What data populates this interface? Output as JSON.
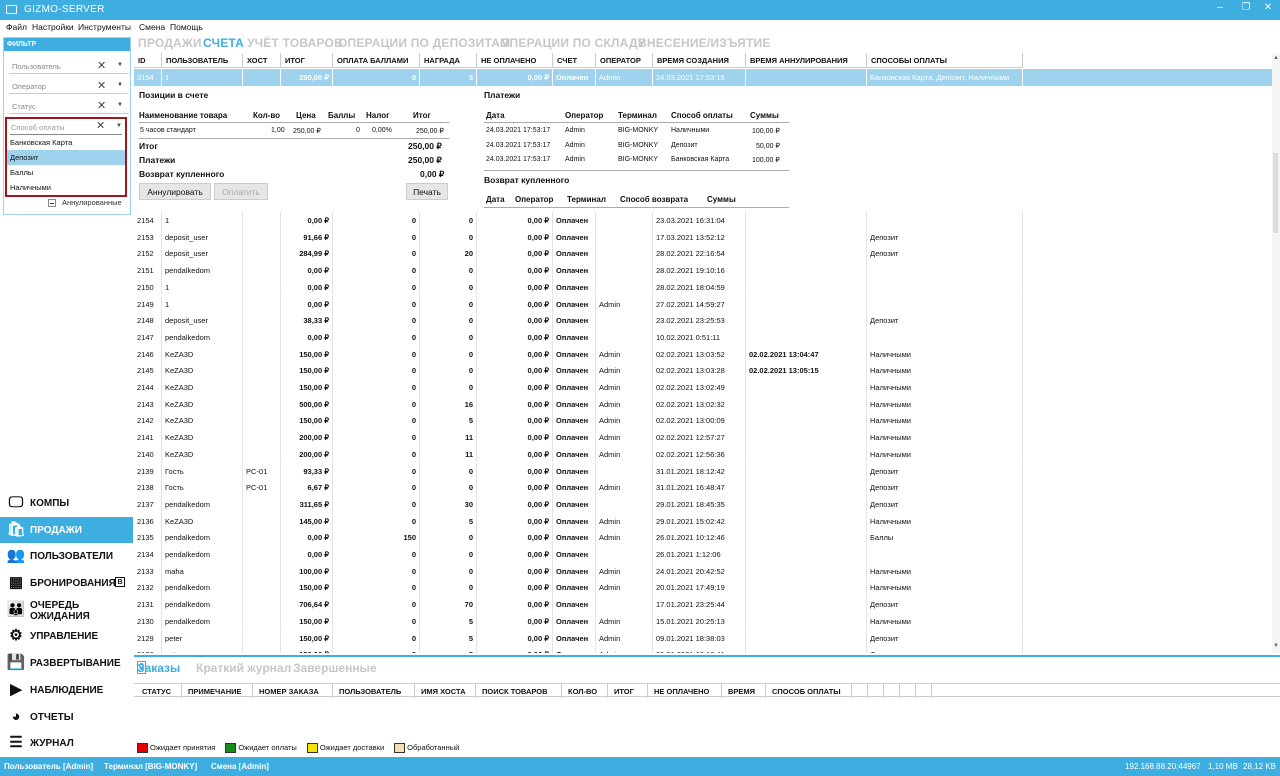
{
  "window": {
    "title": "GIZMO-SERVER"
  },
  "menu": [
    "Файл",
    "Настройки",
    "Инструменты",
    "Смена",
    "Помощь"
  ],
  "filter": {
    "header": "ФИЛЬТР",
    "user_placeholder": "Пользователь",
    "operator_placeholder": "Оператор",
    "status_placeholder": "Статус",
    "payment_placeholder": "Способ оплаты",
    "payment_options": [
      "Банковская Карта",
      "Депозит",
      "Баллы",
      "Наличными"
    ],
    "highlighted_option": "Депозит",
    "annulled_label": "Аннулированные"
  },
  "nav": [
    {
      "label": "КОМПЫ",
      "icon": "monitor-icon"
    },
    {
      "label": "ПРОДАЖИ",
      "icon": "shopping-bag-icon",
      "active": true
    },
    {
      "label": "ПОЛЬЗОВАТЕЛИ",
      "icon": "users-icon"
    },
    {
      "label": "БРОНИРОВАНИЯ",
      "icon": "calendar-icon",
      "badge": "B"
    },
    {
      "label": "ОЧЕРЕДЬ",
      "label2": "ОЖИДАНИЯ",
      "icon": "queue-icon"
    },
    {
      "label": "УПРАВЛЕНИЕ",
      "icon": "gear-icon"
    },
    {
      "label": "РАЗВЕРТЫВАНИЕ",
      "icon": "disk-icon"
    },
    {
      "label": "НАБЛЮДЕНИЕ",
      "icon": "screen-play-icon"
    },
    {
      "label": "ОТЧЕТЫ",
      "icon": "pie-chart-icon"
    },
    {
      "label": "ЖУРНАЛ",
      "icon": "list-icon"
    }
  ],
  "tabs": [
    "ПРОДАЖИ",
    "СЧЕТА",
    "УЧЁТ ТОВАРОВ",
    "ОПЕРАЦИИ ПО ДЕПОЗИТАМ",
    "ОПЕРАЦИИ ПО СКЛАДУ",
    "ВНЕСЕНИЕ/ИЗЪЯТИЕ"
  ],
  "active_tab": "СЧЕТА",
  "grid": {
    "columns": [
      "ID",
      "ПОЛЬЗОВАТЕЛЬ",
      "ХОСТ",
      "ИТОГ",
      "ОПЛАТА БАЛЛАМИ",
      "НАГРАДА",
      "НЕ ОПЛАЧЕНО",
      "СЧЕТ",
      "ОПЕРАТОР",
      "ВРЕМЯ СОЗДАНИЯ",
      "ВРЕМЯ АННУЛИРОВАНИЯ",
      "СПОСОБЫ ОПЛАТЫ"
    ],
    "selected": [
      "3154",
      "1",
      "",
      "250,00 ₽",
      "0",
      "3",
      "0,00 ₽",
      "Оплачен",
      "Admin",
      "24.03.2021 17:53:16",
      "",
      "Банковская Карта, Депозит, Наличными"
    ],
    "rows": [
      [
        "2154",
        "1",
        "",
        "0,00 ₽",
        "0",
        "0",
        "0,00 ₽",
        "Оплачен",
        "",
        "23.03.2021 16:31:04",
        "",
        ""
      ],
      [
        "2153",
        "deposit_user",
        "",
        "91,66 ₽",
        "0",
        "0",
        "0,00 ₽",
        "Оплачен",
        "",
        "17.03.2021 13:52:12",
        "",
        "Депозит"
      ],
      [
        "2152",
        "deposit_user",
        "",
        "284,99 ₽",
        "0",
        "20",
        "0,00 ₽",
        "Оплачен",
        "",
        "28.02.2021 22:16:54",
        "",
        "Депозит"
      ],
      [
        "2151",
        "pendalkedom",
        "",
        "0,00 ₽",
        "0",
        "0",
        "0,00 ₽",
        "Оплачен",
        "",
        "28.02.2021 19:10:16",
        "",
        ""
      ],
      [
        "2150",
        "1",
        "",
        "0,00 ₽",
        "0",
        "0",
        "0,00 ₽",
        "Оплачен",
        "",
        "28.02.2021 18:04:59",
        "",
        ""
      ],
      [
        "2149",
        "1",
        "",
        "0,00 ₽",
        "0",
        "0",
        "0,00 ₽",
        "Оплачен",
        "Admin",
        "27.02.2021 14:59:27",
        "",
        ""
      ],
      [
        "2148",
        "deposit_user",
        "",
        "38,33 ₽",
        "0",
        "0",
        "0,00 ₽",
        "Оплачен",
        "",
        "23.02.2021 23:25:53",
        "",
        "Депозит"
      ],
      [
        "2147",
        "pendalkedom",
        "",
        "0,00 ₽",
        "0",
        "0",
        "0,00 ₽",
        "Оплачен",
        "",
        "10.02.2021 0:51:11",
        "",
        ""
      ],
      [
        "2146",
        "KeZA3D",
        "",
        "150,00 ₽",
        "0",
        "0",
        "0,00 ₽",
        "Оплачен",
        "Admin",
        "02.02.2021 13:03:52",
        "02.02.2021 13:04:47",
        "Наличными"
      ],
      [
        "2145",
        "KeZA3D",
        "",
        "150,00 ₽",
        "0",
        "0",
        "0,00 ₽",
        "Оплачен",
        "Admin",
        "02.02.2021 13:03:28",
        "02.02.2021 13:05:15",
        "Наличными"
      ],
      [
        "2144",
        "KeZA3D",
        "",
        "150,00 ₽",
        "0",
        "0",
        "0,00 ₽",
        "Оплачен",
        "Admin",
        "02.02.2021 13:02:49",
        "",
        "Наличными"
      ],
      [
        "2143",
        "KeZA3D",
        "",
        "500,00 ₽",
        "0",
        "16",
        "0,00 ₽",
        "Оплачен",
        "Admin",
        "02.02.2021 13:02:32",
        "",
        "Наличными"
      ],
      [
        "2142",
        "KeZA3D",
        "",
        "150,00 ₽",
        "0",
        "5",
        "0,00 ₽",
        "Оплачен",
        "Admin",
        "02.02.2021 13:00:09",
        "",
        "Наличными"
      ],
      [
        "2141",
        "KeZA3D",
        "",
        "200,00 ₽",
        "0",
        "11",
        "0,00 ₽",
        "Оплачен",
        "Admin",
        "02.02.2021 12:57:27",
        "",
        "Наличными"
      ],
      [
        "2140",
        "KeZA3D",
        "",
        "200,00 ₽",
        "0",
        "11",
        "0,00 ₽",
        "Оплачен",
        "Admin",
        "02.02.2021 12:56:36",
        "",
        "Наличными"
      ],
      [
        "2139",
        "Гость",
        "PC-01",
        "93,33 ₽",
        "0",
        "0",
        "0,00 ₽",
        "Оплачен",
        "",
        "31.01.2021 18:12:42",
        "",
        "Депозит"
      ],
      [
        "2138",
        "Гость",
        "PC-01",
        "6,67 ₽",
        "0",
        "0",
        "0,00 ₽",
        "Оплачен",
        "Admin",
        "31.01.2021 16:48:47",
        "",
        "Депозит"
      ],
      [
        "2137",
        "pendalkedom",
        "",
        "311,65 ₽",
        "0",
        "30",
        "0,00 ₽",
        "Оплачен",
        "",
        "29.01.2021 18:45:35",
        "",
        "Депозит"
      ],
      [
        "2136",
        "KeZA3D",
        "",
        "145,00 ₽",
        "0",
        "5",
        "0,00 ₽",
        "Оплачен",
        "Admin",
        "29.01.2021 15:02:42",
        "",
        "Наличными"
      ],
      [
        "2135",
        "pendalkedom",
        "",
        "0,00 ₽",
        "150",
        "0",
        "0,00 ₽",
        "Оплачен",
        "Admin",
        "26.01.2021 10:12:46",
        "",
        "Баллы"
      ],
      [
        "2134",
        "pendalkedom",
        "",
        "0,00 ₽",
        "0",
        "0",
        "0,00 ₽",
        "Оплачен",
        "",
        "26.01.2021 1:12:06",
        "",
        ""
      ],
      [
        "2133",
        "maha",
        "",
        "100,00 ₽",
        "0",
        "0",
        "0,00 ₽",
        "Оплачен",
        "Admin",
        "24.01.2021 20:42:52",
        "",
        "Наличными"
      ],
      [
        "2132",
        "pendalkedom",
        "",
        "150,00 ₽",
        "0",
        "0",
        "0,00 ₽",
        "Оплачен",
        "Admin",
        "20.01.2021 17:49:19",
        "",
        "Наличными"
      ],
      [
        "2131",
        "pendalkedom",
        "",
        "706,64 ₽",
        "0",
        "70",
        "0,00 ₽",
        "Оплачен",
        "",
        "17.01.2021 23:25:44",
        "",
        "Депозит"
      ],
      [
        "2130",
        "pendalkedom",
        "",
        "150,00 ₽",
        "0",
        "5",
        "0,00 ₽",
        "Оплачен",
        "Admin",
        "15.01.2021 20:25:13",
        "",
        "Наличными"
      ],
      [
        "2129",
        "peter",
        "",
        "150,00 ₽",
        "0",
        "5",
        "0,00 ₽",
        "Оплачен",
        "Admin",
        "09.01.2021 18:38:03",
        "",
        "Депозит"
      ],
      [
        "2128",
        "peter",
        "",
        "150,00 ₽",
        "0",
        "5",
        "0,00 ₽",
        "Оплачен",
        "Admin",
        "09.01.2021 18:18:41",
        "",
        "Депозит"
      ]
    ]
  },
  "detail": {
    "items_title": "Позиции в счете",
    "items_columns": [
      "Наименование товара",
      "Кол-во",
      "Цена",
      "Баллы",
      "Налог",
      "Итог"
    ],
    "items": [
      [
        "5 часов стандарт",
        "1,00",
        "250,00 ₽",
        "0",
        "0,00%",
        "250,00 ₽"
      ]
    ],
    "totals": [
      [
        "Итог",
        "250,00 ₽"
      ],
      [
        "Платежи",
        "250,00 ₽"
      ],
      [
        "Возврат купленного",
        "0,00 ₽"
      ]
    ],
    "annul_button": "Аннулировать",
    "pay_button": "Оплатить",
    "print_button": "Печать",
    "payments_title": "Платежи",
    "payments_columns": [
      "Дата",
      "Оператор",
      "Терминал",
      "Способ оплаты",
      "Суммы"
    ],
    "payments": [
      [
        "24.03.2021 17:53:17",
        "Admin",
        "BIG-MONKY",
        "Наличными",
        "100,00 ₽"
      ],
      [
        "24.03.2021 17:53:17",
        "Admin",
        "BIG-MONKY",
        "Депозит",
        "50,00 ₽"
      ],
      [
        "24.03.2021 17:53:17",
        "Admin",
        "BIG-MONKY",
        "Банковская Карта",
        "100,00 ₽"
      ]
    ],
    "refund_title": "Возврат купленного",
    "refund_columns": [
      "Дата",
      "Оператор",
      "Терминал",
      "Способ возврата",
      "Суммы"
    ]
  },
  "bottom": {
    "count": "0",
    "tabs": [
      "Заказы",
      "Краткий журнал",
      "Завершенные"
    ],
    "columns": [
      "СТАТУС",
      "ПРИМЕЧАНИЕ",
      "НОМЕР ЗАКАЗА",
      "ПОЛЬЗОВАТЕЛЬ",
      "ИМЯ ХОСТА",
      "ПОИСК ТОВАРОВ",
      "КОЛ-ВО",
      "ИТОГ",
      "НЕ ОПЛАЧЕНО",
      "ВРЕМЯ",
      "СПОСОБ ОПЛАТЫ"
    ],
    "legend": [
      {
        "label": "Ожидает принятия",
        "color": "#e00000"
      },
      {
        "label": "Ожидает оплаты",
        "color": "#1a8a1a"
      },
      {
        "label": "Ожидает доставки",
        "color": "#f5e600"
      },
      {
        "label": "Обработанный",
        "color": "#f7dcb4"
      }
    ]
  },
  "status": {
    "user": "Пользователь [Admin]",
    "terminal": "Терминал [BIG-MONKY]",
    "shift": "Смена [Admin]",
    "address": "192.168.88.20:44967",
    "memory": "1,10 MB",
    "traffic": "28,12 KB"
  },
  "colors": {
    "accent": "#3eaee0",
    "selection": "#9fd2ec",
    "dropdown_border": "#a0161d"
  }
}
